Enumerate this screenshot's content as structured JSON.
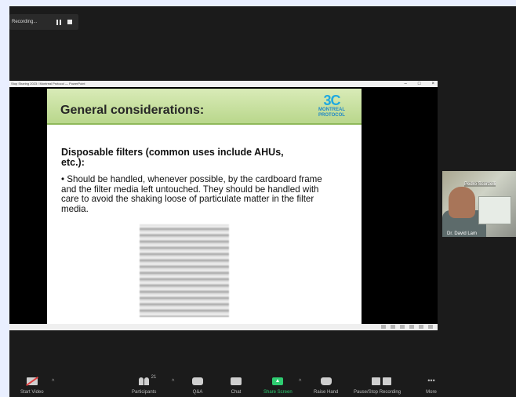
{
  "recording": {
    "label": "Recording..."
  },
  "powerpoint": {
    "window_title": "Stop Sharing 2023 / Montreal Protocol — PowerPoint",
    "controls": [
      "–",
      "□",
      "×"
    ]
  },
  "slide": {
    "title": "General considerations:",
    "logo_big": "3C",
    "logo_line1": "MONTREAL",
    "logo_line2": "PROTOCOL",
    "heading": "Disposable filters (common uses include AHUs, etc.):",
    "bullet": "• Should be handled, whenever possible, by the cardboard frame and the filter media left untouched. They should be handled with care to avoid the shaking loose of particulate matter in the filter media."
  },
  "video_thumb": {
    "top_name": "Pedro Scorzelli",
    "bottom_name": "Dr. David Lam"
  },
  "toolbar": {
    "start_video": "Start Video",
    "participants": "Participants",
    "participants_count": "21",
    "qa": "Q&A",
    "chat": "Chat",
    "share_screen": "Share Screen",
    "raise_hand": "Raise Hand",
    "pause_stop": "Pause/Stop Recording",
    "more": "More",
    "more_glyph": "•••",
    "caret": "^"
  },
  "colors": {
    "background": "#e9efff",
    "meeting_bg": "#1b1b1b",
    "share_green": "#2ecc71",
    "slide_header": "#c5e09d"
  }
}
